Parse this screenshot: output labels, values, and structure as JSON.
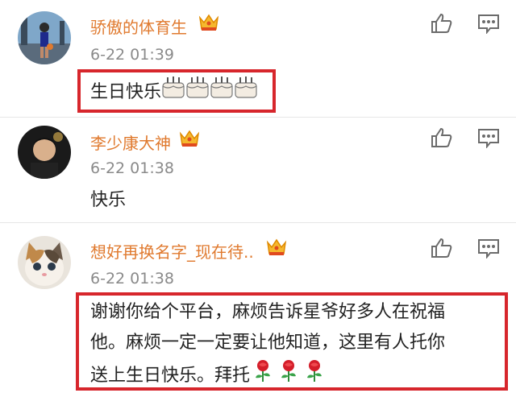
{
  "comments": [
    {
      "username": "骄傲的体育生",
      "time": "6-22 01:39",
      "text": "生日快乐",
      "emoji_icons": [
        "cake-icon",
        "cake-icon",
        "cake-icon",
        "cake-icon"
      ]
    },
    {
      "username": "李少康大神",
      "time": "6-22 01:38",
      "text": "快乐"
    },
    {
      "username": "想好再换名字_现在待..",
      "time": "6-22 01:38",
      "text_lines": [
        "谢谢你给个平台，麻烦告诉星爷好多人在祝福",
        "他。麻烦一定一定要让他知道，这里有人托你",
        "送上生日快乐。拜托"
      ],
      "emoji_icons": [
        "rose-icon",
        "rose-icon",
        "rose-icon"
      ]
    }
  ],
  "colors": {
    "username": "#e07a2f",
    "timestamp": "#8a8a8a",
    "highlight_border": "#d7262c",
    "divider": "#e6e6e6"
  }
}
